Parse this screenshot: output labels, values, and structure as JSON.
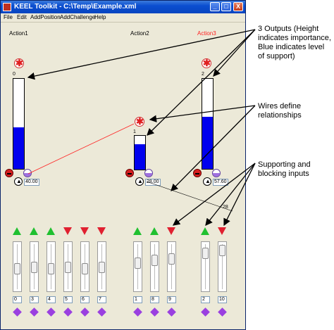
{
  "window": {
    "title": "KEEL Toolkit - C:\\Temp\\Example.xml",
    "minimize_label": "_",
    "maximize_label": "□",
    "close_label": "X"
  },
  "menu": [
    "File",
    "Edit",
    "AddPosition",
    "AddChallenge",
    "Help"
  ],
  "actions": [
    {
      "name": "Action1",
      "value": "0",
      "output": "40.00",
      "fill": 0.46
    },
    {
      "name": "Action2",
      "value": "1",
      "output": "28.00",
      "fill": 0.74
    },
    {
      "name": "Action3",
      "value": "2",
      "output": "57.60",
      "fill": 0.58
    }
  ],
  "wire_value": "28",
  "inputs": {
    "group1": [
      "0",
      "3",
      "4",
      "5",
      "6",
      "7"
    ],
    "group2": [
      "1",
      "8",
      "9"
    ],
    "group3": [
      "2",
      "10"
    ]
  },
  "notes": {
    "outputs": "3 Outputs (Height indicates importance, Blue indicates level of support)",
    "wires": "Wires define relationships",
    "inputs": "Supporting and blocking inputs"
  },
  "colors": {
    "support_fill": "#0000ee",
    "wire": "#ff2020",
    "supporting": "#20c030",
    "blocking": "#e02030"
  }
}
